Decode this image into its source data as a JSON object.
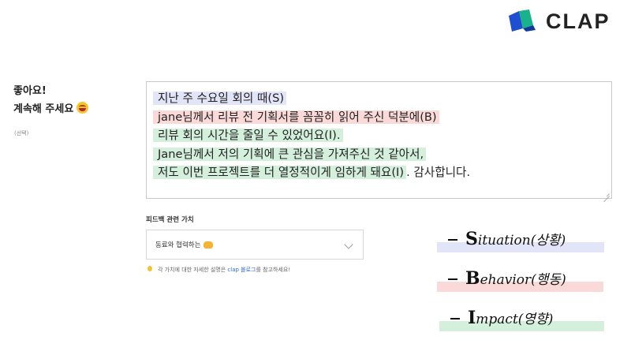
{
  "brand": {
    "name": "CLAP",
    "colors": {
      "blue": "#1f4fd1",
      "teal": "#18b38a",
      "text": "#222222"
    }
  },
  "question": {
    "line1": "좋아요!",
    "line2": "계속해 주세요",
    "emoji": "grinning-face-emoji",
    "optional": "(선택)"
  },
  "feedback": {
    "lines": [
      {
        "text": "지난 주 수요일 회의 때(S)",
        "tag": "S"
      },
      {
        "text": "jane님께서 리뷰 전 기획서를 꼼꼼히 읽어 주신 덕분에(B)",
        "tag": "B"
      },
      {
        "text": "리뷰 회의 시간을 줄일 수 있었어요(I).",
        "tag": "I"
      },
      {
        "text": "Jane님께서 저의 기획에 큰 관심을 가져주신 것 같아서,",
        "tag": "I"
      },
      {
        "text": "저도 이번 프로젝트를 더 열정적이게 임하게 돼요(I)",
        "tag": "I",
        "tail": ". 감사합니다."
      }
    ]
  },
  "value": {
    "label": "피드백 관련 가치",
    "selected": "동료와 협력하는",
    "selected_icon": "handshake-emoji",
    "hint_prefix": "각 가치에 대한 자세한 설명은 ",
    "hint_link": "clap 블로그",
    "hint_suffix": "를 참고하세요!",
    "hint_icon": "lightbulb-icon"
  },
  "legend": [
    {
      "cap": "S",
      "rest": "ituation(상황)",
      "color": "#e2e4f7"
    },
    {
      "cap": "B",
      "rest": "ehavior(행동)",
      "color": "#fad9d9"
    },
    {
      "cap": "I",
      "rest": "mpact(영향)",
      "color": "#d4f0dd"
    }
  ]
}
